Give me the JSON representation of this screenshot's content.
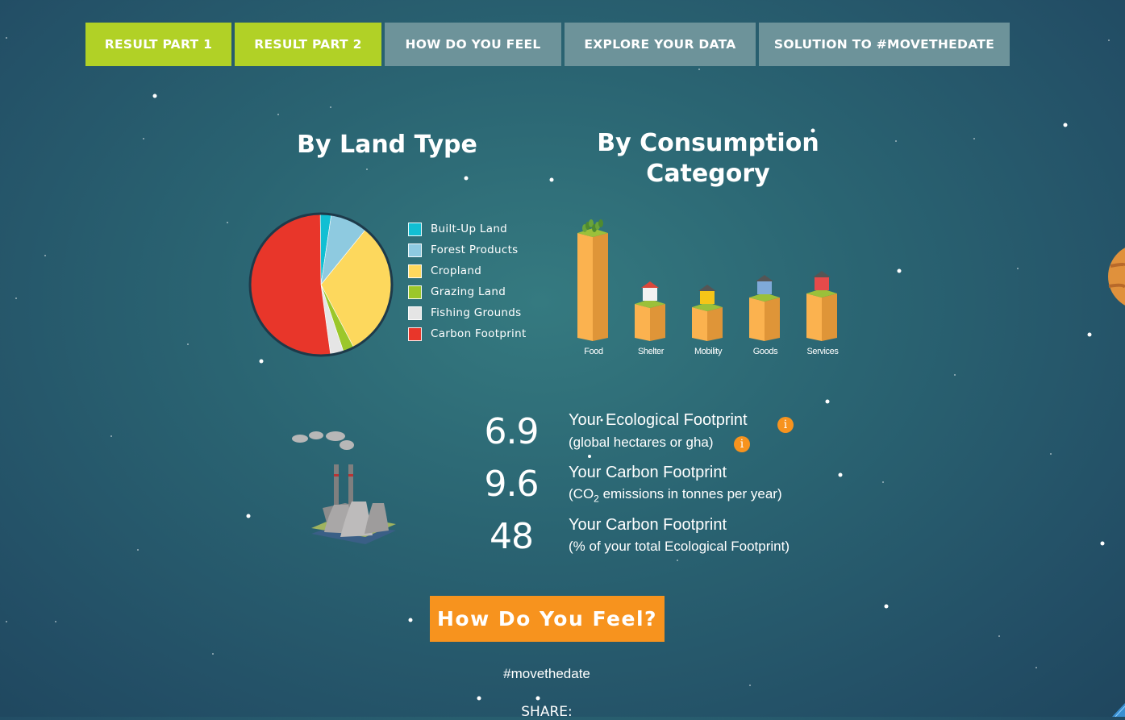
{
  "nav": {
    "tabs": [
      {
        "label": "RESULT PART 1",
        "active": true
      },
      {
        "label": "RESULT PART 2",
        "active": true
      },
      {
        "label": "HOW DO YOU FEEL",
        "active": false
      },
      {
        "label": "EXPLORE YOUR DATA",
        "active": false
      },
      {
        "label": "SOLUTION TO #MOVETHEDATE",
        "active": false
      }
    ]
  },
  "land_type": {
    "title": "By Land Type",
    "legend": [
      {
        "label": "Built-Up Land",
        "color": "#11bfd3"
      },
      {
        "label": "Forest Products",
        "color": "#8ecae0"
      },
      {
        "label": "Cropland",
        "color": "#fdd85d"
      },
      {
        "label": "Grazing Land",
        "color": "#9bc72a"
      },
      {
        "label": "Fishing Grounds",
        "color": "#e5e5e5"
      },
      {
        "label": "Carbon Footprint",
        "color": "#e8362a"
      }
    ]
  },
  "consumption": {
    "title": "By Consumption Category",
    "categories": [
      {
        "label": "Food",
        "icon": "plant-icon"
      },
      {
        "label": "Shelter",
        "icon": "house-icon"
      },
      {
        "label": "Mobility",
        "icon": "car-icon"
      },
      {
        "label": "Goods",
        "icon": "shopping-bag-icon"
      },
      {
        "label": "Services",
        "icon": "shop-icon"
      }
    ]
  },
  "chart_data": [
    {
      "type": "pie",
      "title": "By Land Type",
      "categories": [
        "Built-Up Land",
        "Forest Products",
        "Cropland",
        "Grazing Land",
        "Fishing Grounds",
        "Carbon Footprint"
      ],
      "values": [
        2.5,
        8.5,
        31.5,
        2.5,
        3,
        52
      ],
      "colors": [
        "#11bfd3",
        "#8ecae0",
        "#fdd85d",
        "#9bc72a",
        "#e5e5e5",
        "#e8362a"
      ]
    },
    {
      "type": "bar",
      "title": "By Consumption Category",
      "categories": [
        "Food",
        "Shelter",
        "Mobility",
        "Goods",
        "Services"
      ],
      "values": [
        130,
        42,
        38,
        50,
        55
      ]
    }
  ],
  "stats": [
    {
      "value": "6.9",
      "title": "Your Ecological Footprint",
      "subtitle": "(global hectares or gha)"
    },
    {
      "value": "9.6",
      "title": "Your Carbon Footprint",
      "subtitle_pre": "(CO",
      "subtitle_sub": "2",
      "subtitle_post": " emissions in tonnes per year)"
    },
    {
      "value": "48",
      "title": "Your Carbon Footprint",
      "subtitle": "(% of your total Ecological Footprint)"
    }
  ],
  "info_icon_glyph": "i",
  "cta": {
    "label": "How Do You Feel?"
  },
  "hashtag": "#movethedate",
  "share_label": "SHARE:"
}
